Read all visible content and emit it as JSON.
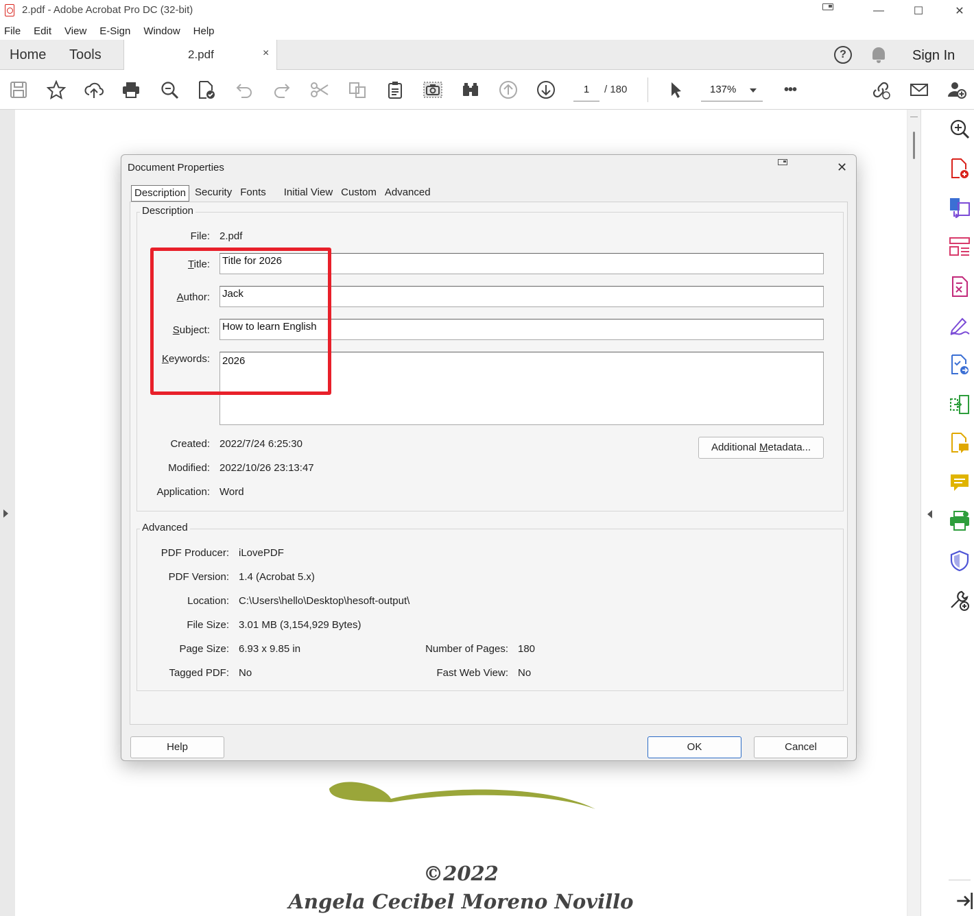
{
  "window": {
    "title": "2.pdf - Adobe Acrobat Pro DC (32-bit)",
    "minimize": "—",
    "maximize": "☐",
    "close": "✕"
  },
  "menu": [
    "File",
    "Edit",
    "View",
    "E-Sign",
    "Window",
    "Help"
  ],
  "tabs": {
    "home": "Home",
    "tools": "Tools",
    "document": "2.pdf",
    "close": "×",
    "sign_in": "Sign In",
    "help": "?"
  },
  "toolbar": {
    "page_current": "1",
    "page_total": "/  180",
    "zoom": "137%",
    "more": "•••"
  },
  "page_content": {
    "copyright": "©2022",
    "author": "Angela Cecibel Moreno Novillo"
  },
  "dialog": {
    "title": "Document Properties",
    "close": "✕",
    "tabs": [
      "Description",
      "Security",
      "Fonts",
      "Initial View",
      "Custom",
      "Advanced"
    ],
    "description": {
      "group_label": "Description",
      "file_label": "File:",
      "file_value": "2.pdf",
      "title_label": "Title:",
      "title_value": "Title for 2026",
      "author_label": "Author:",
      "author_value": "Jack",
      "subject_label": "Subject:",
      "subject_value": "How to learn English",
      "keywords_label": "Keywords:",
      "keywords_value": "2026",
      "created_label": "Created:",
      "created_value": "2022/7/24 6:25:30",
      "modified_label": "Modified:",
      "modified_value": "2022/10/26 23:13:47",
      "application_label": "Application:",
      "application_value": "Word",
      "additional_metadata": "Additional Metadata..."
    },
    "advanced": {
      "group_label": "Advanced",
      "producer_label": "PDF Producer:",
      "producer_value": "iLovePDF",
      "version_label": "PDF Version:",
      "version_value": "1.4 (Acrobat 5.x)",
      "location_label": "Location:",
      "location_value": "C:\\Users\\hello\\Desktop\\hesoft-output\\",
      "filesize_label": "File Size:",
      "filesize_value": "3.01 MB (3,154,929 Bytes)",
      "pagesize_label": "Page Size:",
      "pagesize_value": "6.93 x 9.85 in",
      "numpages_label": "Number of Pages:",
      "numpages_value": "180",
      "tagged_label": "Tagged PDF:",
      "tagged_value": "No",
      "fastweb_label": "Fast Web View:",
      "fastweb_value": "No"
    },
    "buttons": {
      "help": "Help",
      "ok": "OK",
      "cancel": "Cancel"
    }
  },
  "colors": {
    "highlight": "#e8202a",
    "acrobat_red": "#d9231c",
    "primary_button_border": "#2b6bc6",
    "swoosh": "#9aa63a"
  }
}
